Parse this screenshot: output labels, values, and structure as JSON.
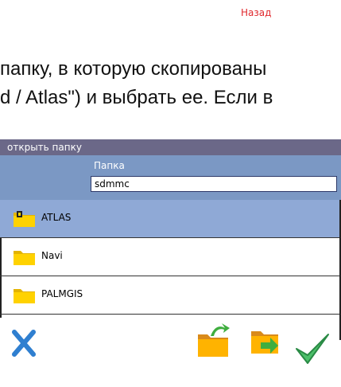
{
  "page": {
    "back_label": "Назад",
    "line1": "папку, в которую скопированы",
    "line2": "d / Atlas\") и выбрать ее. Если в"
  },
  "dialog": {
    "title": "открыть папку",
    "folder_label": "Папка",
    "folder_value": "sdmmc",
    "items": [
      {
        "label": "ATLAS",
        "selected": true
      },
      {
        "label": "Navi",
        "selected": false
      },
      {
        "label": "PALMGIS",
        "selected": false
      }
    ]
  },
  "toolbar": {
    "cancel_icon": "close-x-icon",
    "up_icon": "folder-up-icon",
    "open_icon": "folder-open-icon",
    "ok_icon": "checkmark-icon"
  },
  "colors": {
    "title_bar": "#6b6888",
    "panel": "#7b98c4",
    "selected_row": "#8fa9d6",
    "back_link": "#e0282d",
    "folder_yellow": "#ffd200",
    "ok_green": "#2aa84a",
    "cancel_blue": "#2f7fd0"
  }
}
